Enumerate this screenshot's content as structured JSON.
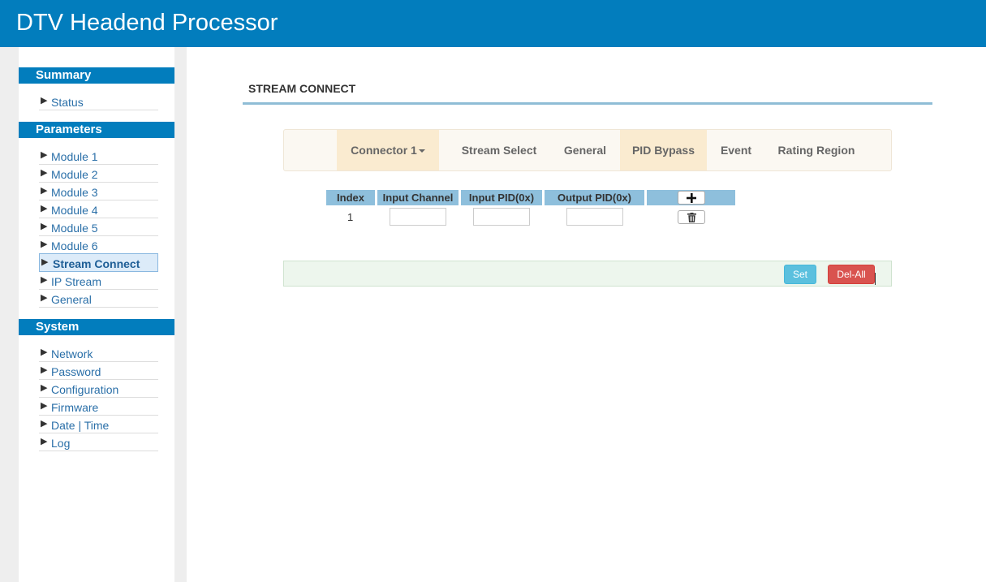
{
  "app": {
    "title": "DTV Headend Processor"
  },
  "sidebar": {
    "summary": {
      "header": "Summary",
      "items": [
        {
          "label": "Status"
        }
      ]
    },
    "parameters": {
      "header": "Parameters",
      "items": [
        {
          "label": "Module 1"
        },
        {
          "label": "Module 2"
        },
        {
          "label": "Module 3"
        },
        {
          "label": "Module 4"
        },
        {
          "label": "Module 5"
        },
        {
          "label": "Module 6"
        },
        {
          "label": "Stream Connect",
          "active": true
        },
        {
          "label": "IP Stream"
        },
        {
          "label": "General"
        }
      ]
    },
    "system": {
      "header": "System",
      "items": [
        {
          "label": "Network"
        },
        {
          "label": "Password"
        },
        {
          "label": "Configuration"
        },
        {
          "label": "Firmware"
        },
        {
          "label": "Date | Time"
        },
        {
          "label": "Log"
        }
      ]
    },
    "arrow_glyph": "▶"
  },
  "main": {
    "page_title": "STREAM CONNECT",
    "tabs": [
      {
        "label": "Connector 1",
        "dropdown": true,
        "highlighted": true
      },
      {
        "label": "Stream Select"
      },
      {
        "label": "General"
      },
      {
        "label": "PID Bypass",
        "highlighted": true
      },
      {
        "label": "Event"
      },
      {
        "label": "Rating Region"
      }
    ],
    "table": {
      "headers": [
        "Index",
        "Input Channel",
        "Input PID(0x)",
        "Output PID(0x)"
      ],
      "add_icon": "plus-icon",
      "rows": [
        {
          "index": "1",
          "input_channel": "",
          "input_pid": "",
          "output_pid": "",
          "delete_icon": "trash-icon"
        }
      ]
    },
    "actions": {
      "set_label": "Set",
      "del_all_label": "Del-All"
    }
  },
  "colors": {
    "header_blue": "#027dbd",
    "table_header": "#8ebfdc",
    "tab_highlight": "#faebd0",
    "set_button": "#5bc0de",
    "del_button": "#d9534f"
  }
}
